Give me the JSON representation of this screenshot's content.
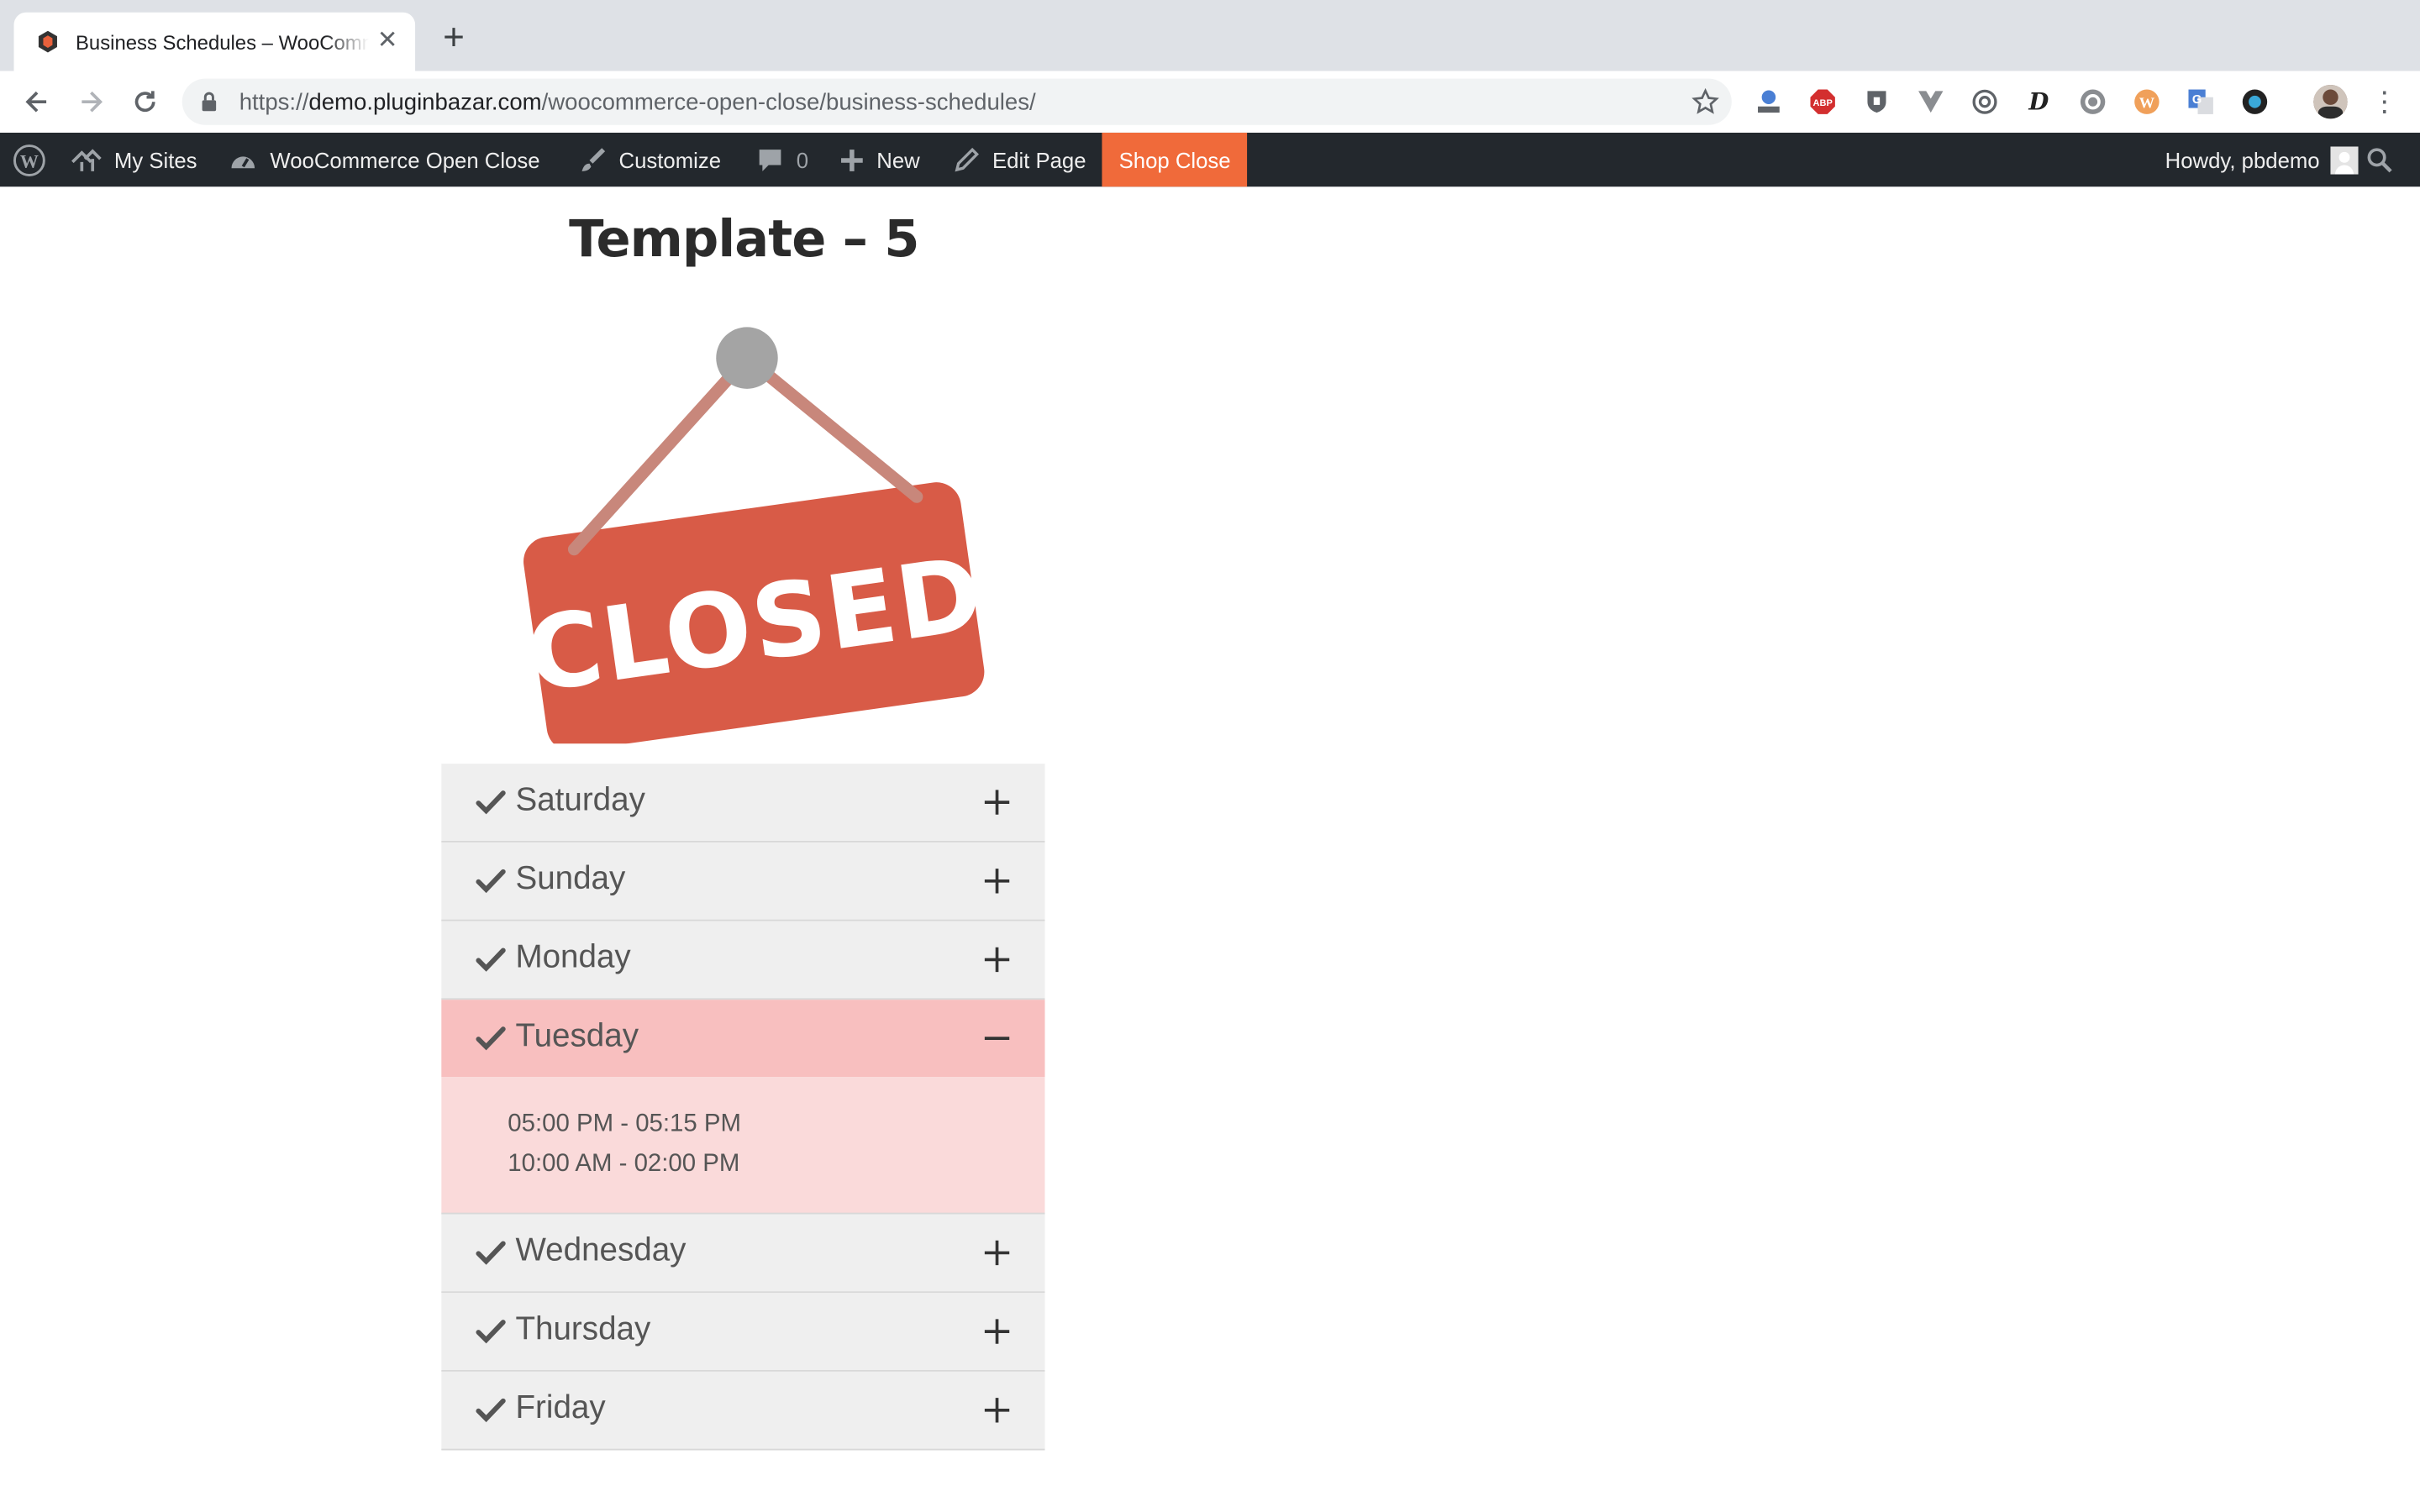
{
  "browser": {
    "tab_title": "Business Schedules – WooCommerce Open Close",
    "url_scheme": "https://",
    "url_host": "demo.pluginbazar.com",
    "url_path": "/woocommerce-open-close/business-schedules/"
  },
  "admin_bar": {
    "my_sites": "My Sites",
    "site_name": "WooCommerce Open Close",
    "customize": "Customize",
    "comments_count": "0",
    "new": "New",
    "edit_page": "Edit Page",
    "shop_close": "Shop Close",
    "howdy": "Howdy, pbdemo"
  },
  "page": {
    "title": "Template – 5",
    "sign_text": "CLOSED"
  },
  "schedule": {
    "days": [
      {
        "label": "Saturday"
      },
      {
        "label": "Sunday"
      },
      {
        "label": "Monday"
      },
      {
        "label": "Tuesday",
        "times": [
          "05:00 PM - 05:15 PM",
          "10:00 AM - 02:00 PM"
        ]
      },
      {
        "label": "Wednesday"
      },
      {
        "label": "Thursday"
      },
      {
        "label": "Friday"
      }
    ]
  },
  "colors": {
    "admin_bar_bg": "#23282d",
    "shop_close_bg": "#f06a3a",
    "sign_red": "#d85b47",
    "active_row": "#f8bfbf",
    "active_panel": "#fadada",
    "row_bg": "#efefef"
  }
}
